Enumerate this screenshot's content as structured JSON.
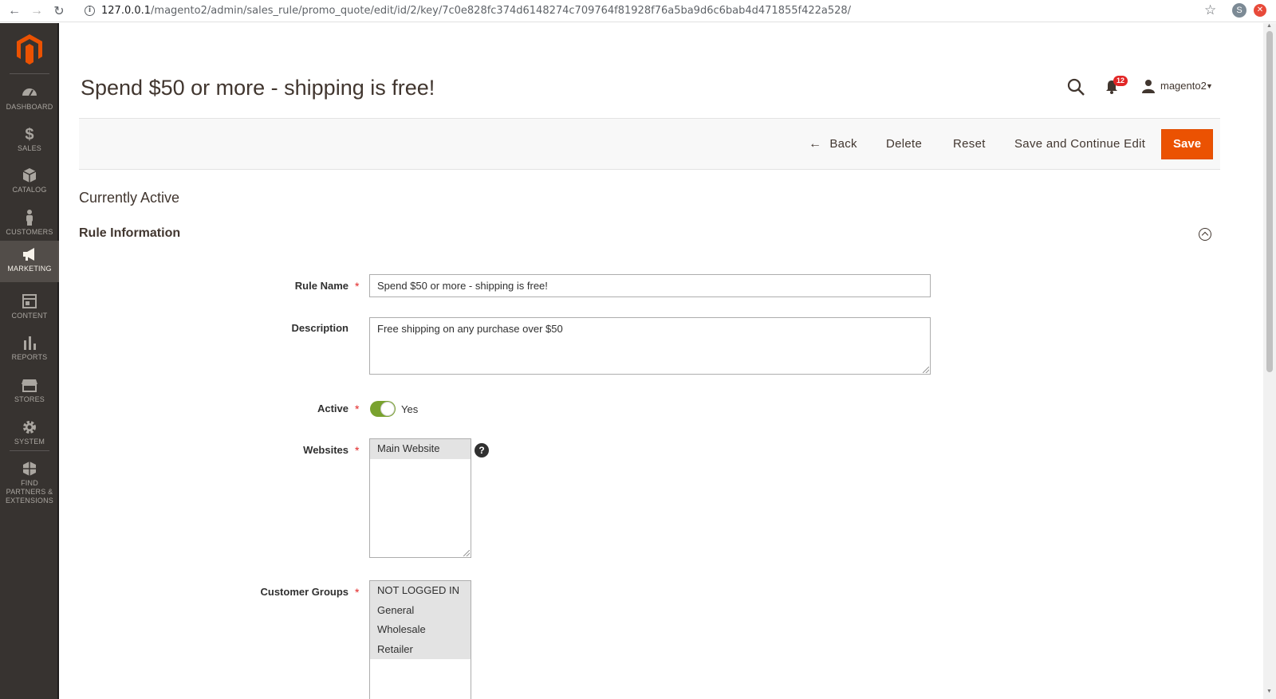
{
  "browser": {
    "url_host": "127.0.0.1",
    "url_path": "/magento2/admin/sales_rule/promo_quote/edit/id/2/key/7c0e828fc374d6148274c709764f81928f76a5ba9d6c6bab4d471855f422a528/",
    "profile_initial": "S"
  },
  "sidebar": {
    "items": [
      {
        "label": "Dashboard",
        "icon": "dashboard-icon"
      },
      {
        "label": "Sales",
        "icon": "dollar-icon"
      },
      {
        "label": "Catalog",
        "icon": "box-icon"
      },
      {
        "label": "Customers",
        "icon": "person-icon"
      },
      {
        "label": "Marketing",
        "icon": "megaphone-icon"
      },
      {
        "label": "Content",
        "icon": "layout-icon"
      },
      {
        "label": "Reports",
        "icon": "bar-chart-icon"
      },
      {
        "label": "Stores",
        "icon": "store-icon"
      },
      {
        "label": "System",
        "icon": "gear-icon"
      },
      {
        "label": "Find Partners & Extensions",
        "icon": "cubes-icon"
      }
    ],
    "active": "Marketing"
  },
  "header": {
    "title": "Spend $50 or more - shipping is free!",
    "notification_count": "12",
    "user_name": "magento2"
  },
  "actions": {
    "back": "Back",
    "delete": "Delete",
    "reset": "Reset",
    "save_continue": "Save and Continue Edit",
    "save": "Save"
  },
  "status": "Currently Active",
  "section": {
    "title": "Rule Information"
  },
  "form": {
    "rule_name_label": "Rule Name",
    "rule_name_value": "Spend $50 or more - shipping is free!",
    "description_label": "Description",
    "description_value": "Free shipping on any purchase over $50",
    "active_label": "Active",
    "active_value": "Yes",
    "websites_label": "Websites",
    "websites_options": [
      "Main Website"
    ],
    "customer_groups_label": "Customer Groups",
    "customer_groups_options": [
      "NOT LOGGED IN",
      "General",
      "Wholesale",
      "Retailer"
    ]
  },
  "colors": {
    "accent": "#eb5202",
    "sidebar_bg": "#373330",
    "toggle_on": "#79a22e",
    "required": "#e22626"
  }
}
